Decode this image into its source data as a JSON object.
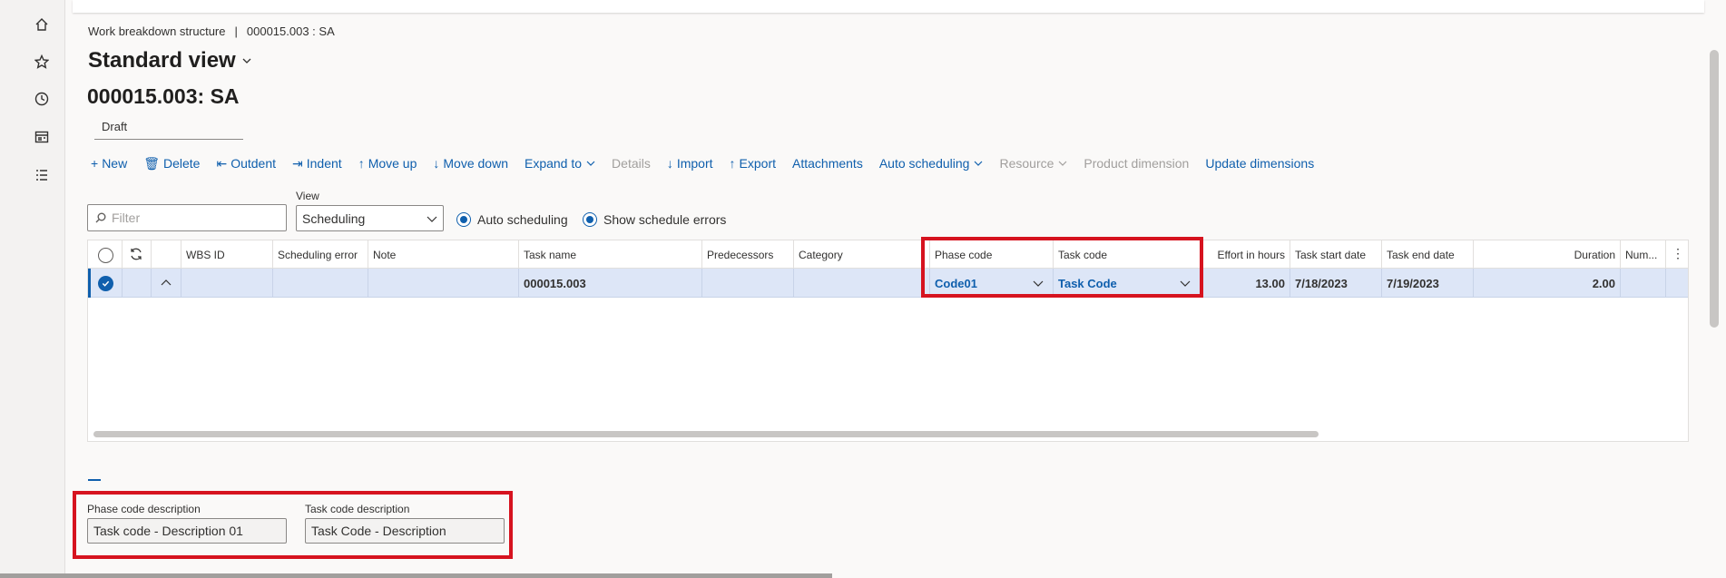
{
  "nav": {
    "items": [
      {
        "name": "home-icon"
      },
      {
        "name": "star-icon"
      },
      {
        "name": "clock-icon"
      },
      {
        "name": "workspace-icon"
      },
      {
        "name": "list-icon"
      }
    ]
  },
  "breadcrumb": {
    "section": "Work breakdown structure",
    "separator": "|",
    "record": "000015.003 : SA"
  },
  "view_name": "Standard view",
  "record_title": "000015.003: SA",
  "status": "Draft",
  "toolbar": {
    "new": "New",
    "delete": "Delete",
    "outdent": "Outdent",
    "indent": "Indent",
    "move_up": "Move up",
    "move_down": "Move down",
    "expand_to": "Expand to",
    "details": "Details",
    "import": "Import",
    "export": "Export",
    "attachments": "Attachments",
    "auto_scheduling": "Auto scheduling",
    "resource": "Resource",
    "product_dimension": "Product dimension",
    "update_dimensions": "Update dimensions"
  },
  "filter": {
    "placeholder": "Filter"
  },
  "view": {
    "label": "View",
    "value": "Scheduling"
  },
  "options": {
    "auto_scheduling": "Auto scheduling",
    "show_schedule_errors": "Show schedule errors"
  },
  "grid": {
    "headers": {
      "wbs_id": "WBS ID",
      "scheduling_error": "Scheduling error",
      "note": "Note",
      "task_name": "Task name",
      "predecessors": "Predecessors",
      "category": "Category",
      "phase_code": "Phase code",
      "task_code": "Task code",
      "effort": "Effort in hours",
      "start": "Task start date",
      "end": "Task end date",
      "duration": "Duration",
      "num": "Num..."
    },
    "row": {
      "task_name": "000015.003",
      "phase_code": "Code01",
      "task_code": "Task Code",
      "effort": "13.00",
      "start": "7/18/2023",
      "end": "7/19/2023",
      "duration": "2.00"
    }
  },
  "details": {
    "phase_label": "Phase code description",
    "phase_value": "Task code - Description 01",
    "task_label": "Task code description",
    "task_value": "Task Code - Description"
  },
  "colors": {
    "accent": "#0f5fad",
    "highlight": "#d6131f",
    "selected_row": "#dde6f7"
  }
}
